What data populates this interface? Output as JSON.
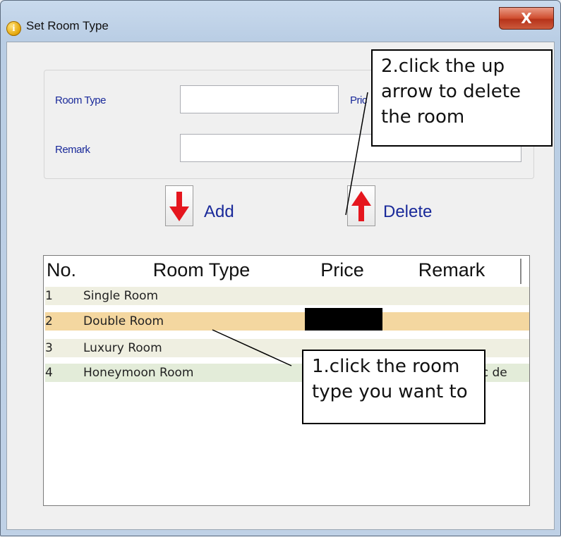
{
  "window": {
    "title": "Set Room Type",
    "close_glyph": "X"
  },
  "form": {
    "room_type_label": "Room Type",
    "price_label": "Pric",
    "remark_label": "Remark",
    "room_type_value": "",
    "price_value": "",
    "remark_value": ""
  },
  "actions": {
    "add_label": "Add",
    "delete_label": "Delete",
    "add_icon": "arrow-down-icon",
    "delete_icon": "arrow-up-icon",
    "arrow_color": "#e5161e"
  },
  "table": {
    "columns": [
      "No.",
      "Room Type",
      "Price",
      "Remark"
    ],
    "rows": [
      {
        "no": "1",
        "room_type": "Single Room",
        "price": "",
        "remark": ""
      },
      {
        "no": "2",
        "room_type": "Double Room",
        "price": "",
        "remark": "",
        "selected": true
      },
      {
        "no": "3",
        "room_type": "Luxury Room",
        "price": "",
        "remark": ""
      },
      {
        "no": "4",
        "room_type": "Honeymoon Room",
        "price": "",
        "remark": "ic de"
      }
    ],
    "selected_row_color": "#f4d7a0"
  },
  "annotations": {
    "callout_delete": [
      "2.click the up",
      "arrow to delete",
      "the room"
    ],
    "callout_select": [
      "1.click the room",
      "type you want to"
    ]
  }
}
